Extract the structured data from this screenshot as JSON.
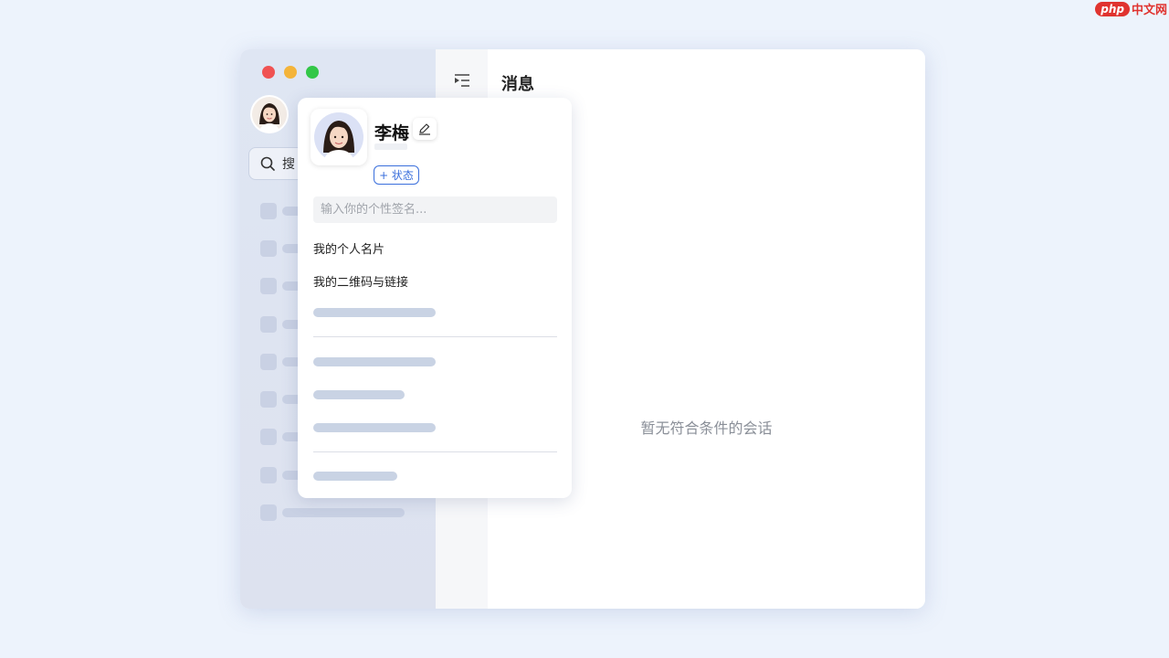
{
  "watermark": {
    "badge": "php",
    "text": "中文网"
  },
  "window": {
    "traffic_lights": [
      "#f05252",
      "#f4b43a",
      "#33c748"
    ],
    "sidebar": {
      "search_label": "搜"
    },
    "main": {
      "title": "消息",
      "empty_text": "暂无符合条件的会话"
    }
  },
  "profile_popup": {
    "name": "李梅",
    "status_button": "+ 状态",
    "signature_placeholder": "输入你的个性签名...",
    "menu": [
      "我的个人名片",
      "我的二维码与链接"
    ],
    "accent_color": "#3a6fdc"
  },
  "icons": {
    "search": "search-icon",
    "edit": "pencil-icon",
    "sidebar_toggle": "menu-indent-icon",
    "avatar": "avatar"
  }
}
